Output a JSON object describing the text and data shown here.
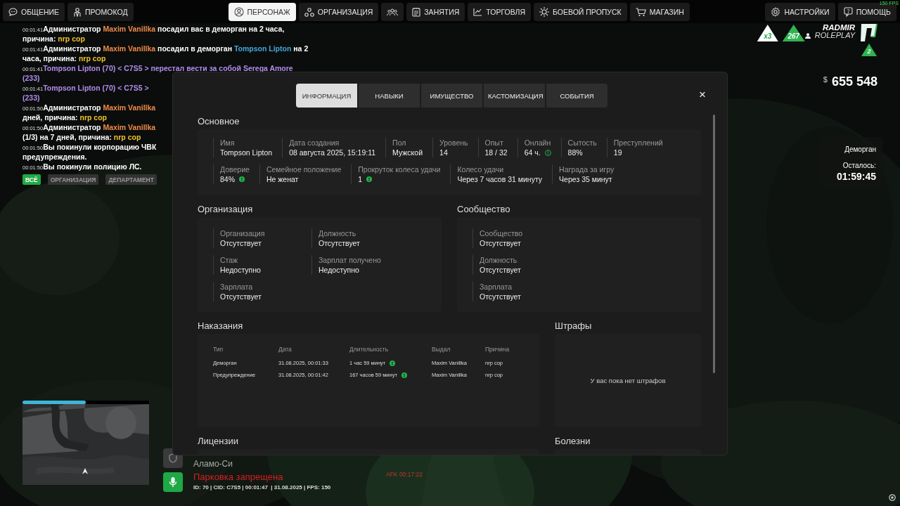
{
  "nav": {
    "left": [
      {
        "label": "ОБЩЕНИЕ",
        "selected": false
      },
      {
        "label": "ПРОМОКОД",
        "selected": false
      }
    ],
    "center": [
      {
        "label": "ПЕРСОНАЖ",
        "selected": true
      },
      {
        "label": "ОРГАНИЗАЦИЯ",
        "selected": false
      },
      {
        "selected": false
      },
      {
        "label": "ЗАНЯТИЯ",
        "selected": false
      },
      {
        "label": "ТОРГОВЛЯ",
        "selected": false
      },
      {
        "label": "БОЕВОЙ ПРОПУСК",
        "selected": false
      },
      {
        "label": "МАГАЗИН",
        "selected": false
      }
    ],
    "right": [
      {
        "label": "НАСТРОЙКИ",
        "selected": false
      },
      {
        "label": "ПОМОЩЬ",
        "selected": false
      }
    ]
  },
  "fps": "150 FPS",
  "chat": {
    "messages": [
      {
        "time": "00:01:41",
        "lines": [
          [
            {
              "text": "Администратор ",
              "color": "#ffffff"
            },
            {
              "text": "Maxim Vanillka",
              "color": "#f0894a"
            },
            {
              "text": " посадил вас в деморган на 2 часа,",
              "color": "#ffffff"
            }
          ],
          [
            {
              "text": "причина: ",
              "color": "#ffffff"
            },
            {
              "text": "nrp cop",
              "color": "#f2c230"
            }
          ]
        ]
      },
      {
        "time": "00:01:41",
        "lines": [
          [
            {
              "text": "Администратор ",
              "color": "#ffffff"
            },
            {
              "text": "Maxim Vanillka",
              "color": "#f0894a"
            },
            {
              "text": " посадил в деморган ",
              "color": "#ffffff"
            },
            {
              "text": "Tompson Lipton",
              "color": "#45a6dc"
            },
            {
              "text": " на 2",
              "color": "#ffffff"
            }
          ],
          [
            {
              "text": "часа, причина: ",
              "color": "#ffffff"
            },
            {
              "text": "nrp cop",
              "color": "#f2c230"
            }
          ]
        ]
      },
      {
        "time": "00:01:41",
        "lines": [
          [
            {
              "text": "Tompson Lipton (70) < C7S5 > перестал вести за собой Serega Amore",
              "color": "#b28cec"
            }
          ],
          [
            {
              "text": "(233)",
              "color": "#b28cec"
            }
          ]
        ]
      },
      {
        "time": "00:01:41",
        "lines": [
          [
            {
              "text": "Tompson Lipton (70) < C7S5 >",
              "color": "#b28cec"
            }
          ],
          [
            {
              "text": "(233)",
              "color": "#b28cec"
            }
          ]
        ]
      },
      {
        "time": "00:01:50",
        "lines": [
          [
            {
              "text": "Администратор ",
              "color": "#ffffff"
            },
            {
              "text": "Maxim Vanillka",
              "color": "#f0894a"
            }
          ],
          [
            {
              "text": "дней, причина: ",
              "color": "#ffffff"
            },
            {
              "text": "nrp cop",
              "color": "#f2c230"
            }
          ]
        ]
      },
      {
        "time": "00:01:50",
        "lines": [
          [
            {
              "text": "Администратор ",
              "color": "#ffffff"
            },
            {
              "text": "Maxim Vanillka",
              "color": "#f0894a"
            }
          ],
          [
            {
              "text": "(1/3) на 7 дней, причина: ",
              "color": "#ffffff"
            },
            {
              "text": "nrp cop",
              "color": "#f2c230"
            }
          ]
        ]
      },
      {
        "time": "00:01:50",
        "lines": [
          [
            {
              "text": "Вы покинули корпорацию ЧВК",
              "color": "#ffffff"
            }
          ],
          [
            {
              "text": "предупреждения.",
              "color": "#ffffff"
            }
          ]
        ]
      },
      {
        "time": "00:01:50",
        "lines": [
          [
            {
              "text": "Вы покинули полицию ЛС.",
              "color": "#ffffff"
            }
          ]
        ]
      }
    ],
    "filters": [
      {
        "label": "ВСЁ",
        "selected": true
      },
      {
        "label": "ОРГАНИЗАЦИЯ",
        "selected": false
      },
      {
        "label": "ДЕПАРТАМЕНТ",
        "selected": false
      }
    ]
  },
  "hud": {
    "multiplier": "x3",
    "online": "267",
    "brand": {
      "line1": "RADMIR",
      "line2": "ROLEPLAY",
      "server": "2"
    },
    "money": {
      "currency": "$",
      "amount": "655 548"
    },
    "jail": {
      "title": "Деморган",
      "remaining_label": "Осталось:",
      "time": "01:59:45"
    }
  },
  "minimap": {
    "kind": "picture",
    "level": 0.5
  },
  "status": {
    "location": "Аламо-Си",
    "zone": "Парковка запрещена",
    "info": "ID: 70 | CID: C7S5 | 00:01:47  | 31.08.2025 | FPS: 150",
    "afk": "AFK 00:17:22"
  },
  "profile": {
    "tabs": [
      {
        "label": "ИНФОРМАЦИЯ",
        "selected": true
      },
      {
        "label": "НАВЫКИ",
        "selected": false
      },
      {
        "label": "ИМУЩЕСТВО",
        "selected": false
      },
      {
        "label": "КАСТОМИЗАЦИЯ",
        "selected": false
      },
      {
        "label": "СОБЫТИЯ",
        "selected": false
      }
    ],
    "close": "×",
    "main": {
      "title": "Основное",
      "lines": [
        {
          "fields": [
            {
              "label": "Имя",
              "value": "Tompson Lipton",
              "kind": "plain"
            },
            {
              "label": "Дата создания",
              "value": "08 августа 2025, 15:19:11",
              "kind": "plain"
            },
            {
              "label": "Пол",
              "value": "Мужской",
              "kind": "plain"
            },
            {
              "label": "Уровень",
              "value": "14",
              "kind": "plain"
            },
            {
              "label": "Опыт",
              "value": "18 / 32",
              "kind": "plain"
            },
            {
              "label": "Онлайн",
              "value": "64 ч.",
              "kind": "hint-outline"
            },
            {
              "label": "Сытость",
              "value": "88%",
              "kind": "plain"
            },
            {
              "label": "Преступлений",
              "value": "19",
              "kind": "plain"
            }
          ]
        },
        {
          "fields": [
            {
              "label": "Доверие",
              "value": "84%",
              "kind": "hint"
            },
            {
              "label": "Семейное положение",
              "value": "Не женат",
              "kind": "plain"
            },
            {
              "label": "Прокруток колеса удачи",
              "value": "1",
              "kind": "hint"
            },
            {
              "label": "Колесо удачи",
              "value": "Через 7 часов 31 минуту",
              "kind": "plain"
            },
            {
              "label": "Награда за игру",
              "value": "Через 35 минут",
              "kind": "plain"
            }
          ]
        }
      ]
    },
    "organization": {
      "title": "Организация",
      "columns": [
        [
          {
            "label": "Организация",
            "value": "Отсутствует"
          },
          {
            "label": "Стаж",
            "value": "Недоступно"
          },
          {
            "label": "Зарплата",
            "value": "Отсутствует"
          }
        ],
        [
          {
            "label": "Должность",
            "value": "Отсутствует"
          },
          {
            "label": "Зарплат получено",
            "value": "Недоступно"
          }
        ]
      ]
    },
    "community": {
      "title": "Сообщество",
      "columns": [
        [
          {
            "label": "Сообщество",
            "value": "Отсутствует"
          },
          {
            "label": "Должность",
            "value": "Отсутствует"
          },
          {
            "label": "Зарплата",
            "value": "Отсутствует"
          }
        ]
      ]
    },
    "punishments": {
      "title": "Наказания",
      "columns": [
        "Тип",
        "Дата",
        "Длительность",
        "Выдал",
        "Причина"
      ],
      "rows": [
        {
          "cells": [
            "Деморган",
            "31.08.2025, 00:01:33",
            "1 час 59 минут",
            "Maxim Vanillka",
            "nrp cop"
          ],
          "hint": true
        },
        {
          "cells": [
            "Предупреждение",
            "31.08.2025, 00:01:42",
            "167 часов 59 минут",
            "Maxim Vanillka",
            "nrp cop"
          ],
          "hint": true
        }
      ]
    },
    "fines": {
      "title": "Штрафы",
      "empty": "У вас пока нет штрафов"
    },
    "licenses": {
      "title": "Лицензии"
    },
    "diseases": {
      "title": "Болезни"
    }
  }
}
